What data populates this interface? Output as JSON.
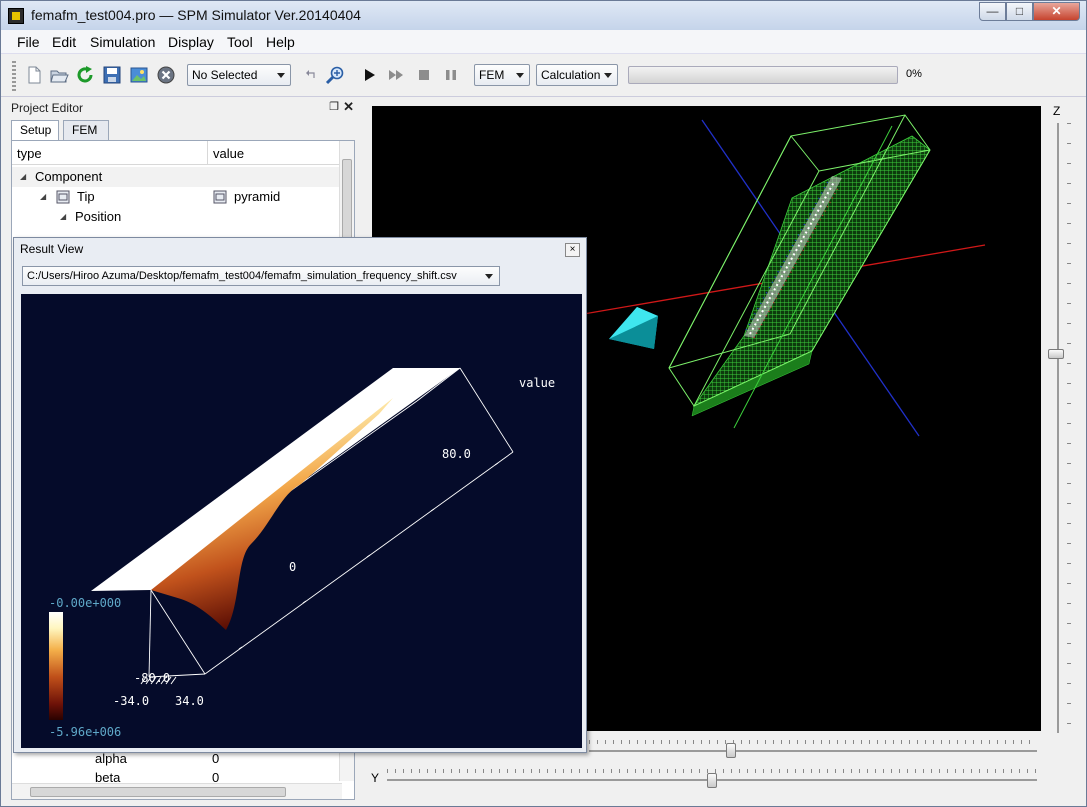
{
  "window": {
    "title": "femafm_test004.pro — SPM Simulator Ver.20140404",
    "min_glyph": "—",
    "max_glyph": "□",
    "close_glyph": "✕"
  },
  "menu": [
    "File",
    "Edit",
    "Simulation",
    "Display",
    "Tool",
    "Help"
  ],
  "toolbar": {
    "selection": "No Selected",
    "mode": "FEM",
    "action": "Calculation",
    "progress_percent": 0,
    "progress_label": "0%"
  },
  "project_editor": {
    "title": "Project Editor",
    "tabs": [
      "Setup",
      "FEM"
    ],
    "columns": {
      "type": "type",
      "value": "value"
    },
    "rows": {
      "component": "Component",
      "tip": "Tip",
      "tip_value": "pyramid",
      "position": "Position",
      "alpha": "alpha",
      "alpha_value": "0",
      "beta": "beta",
      "beta_value": "0"
    }
  },
  "viewport": {
    "z_label": "Z",
    "y_label": "Y"
  },
  "result_view": {
    "title": "Result View",
    "close_glyph": "×",
    "file_path": "C:/Users/Hiroo Azuma/Desktop/femafm_test004/femafm_simulation_frequency_shift.csv",
    "value_label": "value",
    "colorbar_max": "-0.00e+000",
    "colorbar_min": "-5.96e+006",
    "axis_far": "80.0",
    "axis_near": "-80.0",
    "axis_x_left": "-34.0",
    "axis_x_right": "34.0",
    "axis_mid": "0"
  },
  "colors": {
    "viewport_bg": "#000000",
    "plot_bg": "#050b2a",
    "sample_green": "#3ccf3c",
    "tip_cyan": "#19d3de",
    "axis_red": "#d01818",
    "axis_blue": "#2030c8",
    "colorbar_label": "#5fa8c8"
  }
}
